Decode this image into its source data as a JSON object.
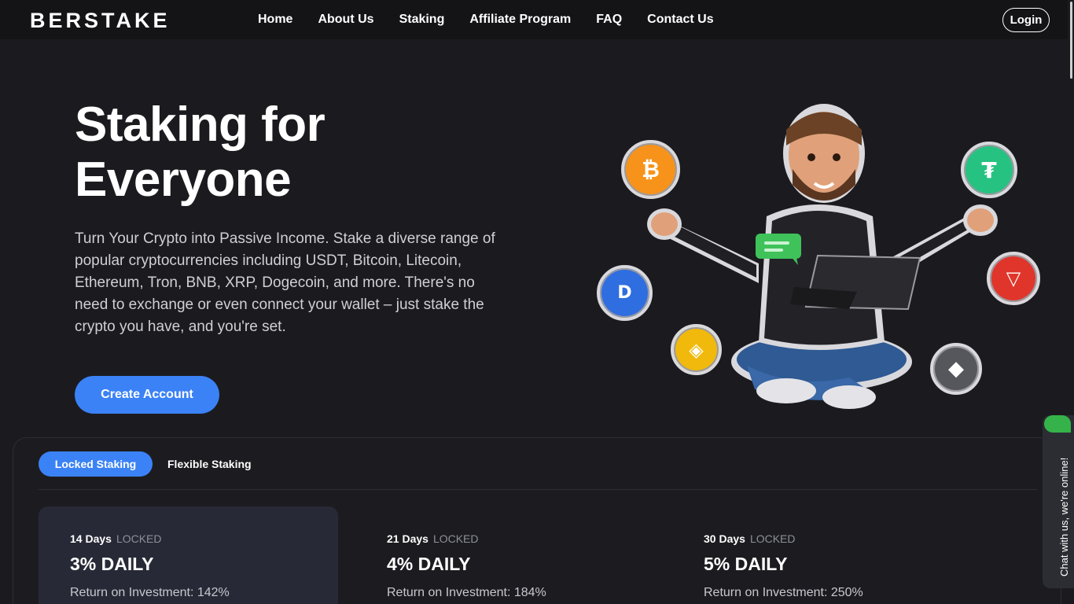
{
  "nav": {
    "logo": "BERSTAKE",
    "links": [
      "Home",
      "About Us",
      "Staking",
      "Affiliate Program",
      "FAQ",
      "Contact Us"
    ],
    "login": "Login"
  },
  "hero": {
    "title_line1": "Staking for",
    "title_line2": "Everyone",
    "text": "Turn Your Crypto into Passive Income. Stake a diverse range of popular cryptocurrencies including USDT, Bitcoin, Litecoin, Ethereum, Tron, BNB, XRP, Dogecoin, and more. There's no need to exchange or even connect your wallet – just stake the crypto you have, and you're set.",
    "cta": "Create Account"
  },
  "coins": [
    {
      "name": "bitcoin",
      "color": "#f7931a"
    },
    {
      "name": "tether",
      "color": "#26c281"
    },
    {
      "name": "dash",
      "color": "#2f6ee0"
    },
    {
      "name": "tron",
      "color": "#e0352b"
    },
    {
      "name": "bnb",
      "color": "#f0b90b"
    },
    {
      "name": "ethereum",
      "color": "#55575c"
    }
  ],
  "staking": {
    "tabs": {
      "active": "Locked Staking",
      "inactive": "Flexible Staking"
    },
    "plans": [
      {
        "days": "14 Days",
        "status": "LOCKED",
        "rate": "3% DAILY",
        "roi": "Return on Investment: 142%"
      },
      {
        "days": "21 Days",
        "status": "LOCKED",
        "rate": "4% DAILY",
        "roi": "Return on Investment: 184%"
      },
      {
        "days": "30 Days",
        "status": "LOCKED",
        "rate": "5% DAILY",
        "roi": "Return on Investment: 250%"
      }
    ]
  },
  "chat": {
    "label": "Chat with us, we're online!"
  },
  "colors": {
    "accent": "#3b82f6",
    "background": "#1b1b1f",
    "nav": "#141417",
    "chat_green": "#35b34a"
  }
}
